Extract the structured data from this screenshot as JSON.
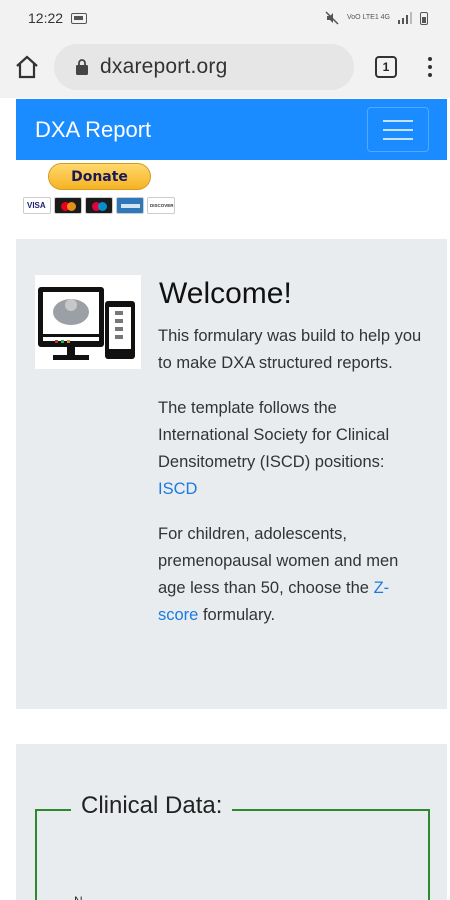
{
  "status_bar": {
    "time": "12:22",
    "network_label": "VoO LTE1 4G"
  },
  "browser": {
    "url": "dxareport.org",
    "tab_count": "1"
  },
  "navbar": {
    "brand": "DXA Report"
  },
  "donate": {
    "label": "Donate",
    "cards": [
      "visa",
      "mastercard",
      "maestro",
      "amex",
      "discover"
    ]
  },
  "welcome": {
    "title": "Welcome!",
    "paragraph1": "This formulary was build to help you to make DXA structured reports.",
    "paragraph2_text": "The template follows the International Society for Clinical Densitometry (ISCD) positions:",
    "paragraph2_link": "ISCD",
    "paragraph3_text": "For children, adolescents, premenopausal women and men age less than 50, choose the",
    "paragraph3_link": "Z-score",
    "paragraph3_end": "formulary."
  },
  "clinical": {
    "legend": "Clinical Data:",
    "first_label": "N"
  },
  "colors": {
    "navbar": "#1a8cff",
    "jumbotron": "#e9ecef",
    "link": "#1a7be0",
    "fieldset_border": "#2c8a2c"
  }
}
